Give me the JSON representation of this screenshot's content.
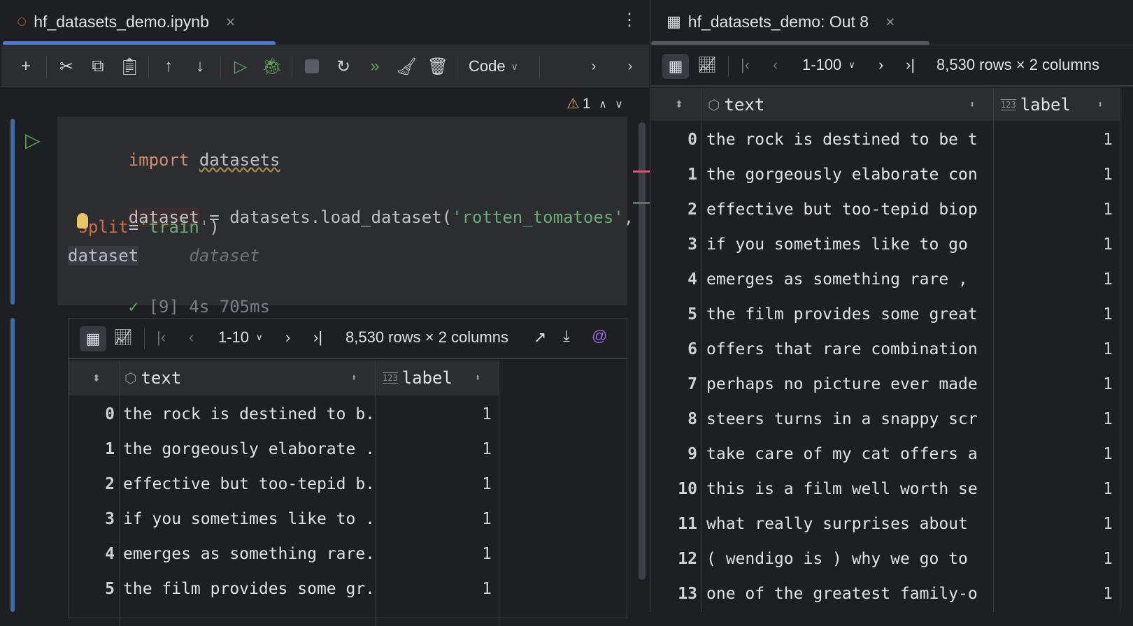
{
  "left_tab": {
    "title": "hf_datasets_demo.ipynb",
    "close": "×",
    "more": "⋮"
  },
  "toolbar": {
    "cell_type": "Code"
  },
  "inspections": {
    "warning_count": "1"
  },
  "code_cell": {
    "line1_keyword": "import",
    "line1_module": "datasets",
    "line2_var": "dataset",
    "line2_eq": " = datasets.load_dataset(",
    "line2_str": "'rotten_tomatoes'",
    "line2_comma": ",",
    "line3_param": "split",
    "line3_eq": "=",
    "line3_str": "'train'",
    "line3_close": ")",
    "line4_var": "dataset",
    "line4_hint": "dataset",
    "exec_count": "[9]",
    "exec_time": "4s 705ms"
  },
  "inline_table": {
    "page_range": "1-10",
    "summary": "8,530 rows × 2 columns",
    "columns": [
      "text",
      "label"
    ],
    "label_type": "123",
    "rows": [
      {
        "index": "0",
        "text": "the rock is destined to b.",
        "label": "1"
      },
      {
        "index": "1",
        "text": "the gorgeously elaborate .",
        "label": "1"
      },
      {
        "index": "2",
        "text": "effective but too-tepid b.",
        "label": "1"
      },
      {
        "index": "3",
        "text": "if you sometimes like to .",
        "label": "1"
      },
      {
        "index": "4",
        "text": "emerges as something rare.",
        "label": "1"
      },
      {
        "index": "5",
        "text": "the film provides some gr.",
        "label": "1"
      }
    ]
  },
  "right_tab": {
    "title": "hf_datasets_demo: Out 8",
    "close": "×"
  },
  "full_table": {
    "page_range": "1-100",
    "summary": "8,530 rows × 2 columns",
    "columns": [
      "text",
      "label"
    ],
    "label_type": "123",
    "rows": [
      {
        "index": "0",
        "text": "the rock is destined to be t",
        "label": "1"
      },
      {
        "index": "1",
        "text": "the gorgeously elaborate con",
        "label": "1"
      },
      {
        "index": "2",
        "text": "effective but too-tepid biop",
        "label": "1"
      },
      {
        "index": "3",
        "text": "if you sometimes like to go",
        "label": "1"
      },
      {
        "index": "4",
        "text": "emerges as something rare ,",
        "label": "1"
      },
      {
        "index": "5",
        "text": "the film provides some great",
        "label": "1"
      },
      {
        "index": "6",
        "text": "offers that rare combination",
        "label": "1"
      },
      {
        "index": "7",
        "text": "perhaps no picture ever made",
        "label": "1"
      },
      {
        "index": "8",
        "text": "steers turns in a snappy scr",
        "label": "1"
      },
      {
        "index": "9",
        "text": "take care of my cat offers a",
        "label": "1"
      },
      {
        "index": "10",
        "text": "this is a film well worth se",
        "label": "1"
      },
      {
        "index": "11",
        "text": "what really surprises about",
        "label": "1"
      },
      {
        "index": "12",
        "text": "( wendigo is ) why we go to",
        "label": "1"
      },
      {
        "index": "13",
        "text": "one of the greatest family-o",
        "label": "1"
      }
    ]
  },
  "colors": {
    "bg": "#1e1f22",
    "panel": "#2b2d30",
    "accent": "#4a78e0",
    "keyword": "#cf8e6d",
    "string": "#6aab73",
    "run_green": "#5fa35a"
  }
}
